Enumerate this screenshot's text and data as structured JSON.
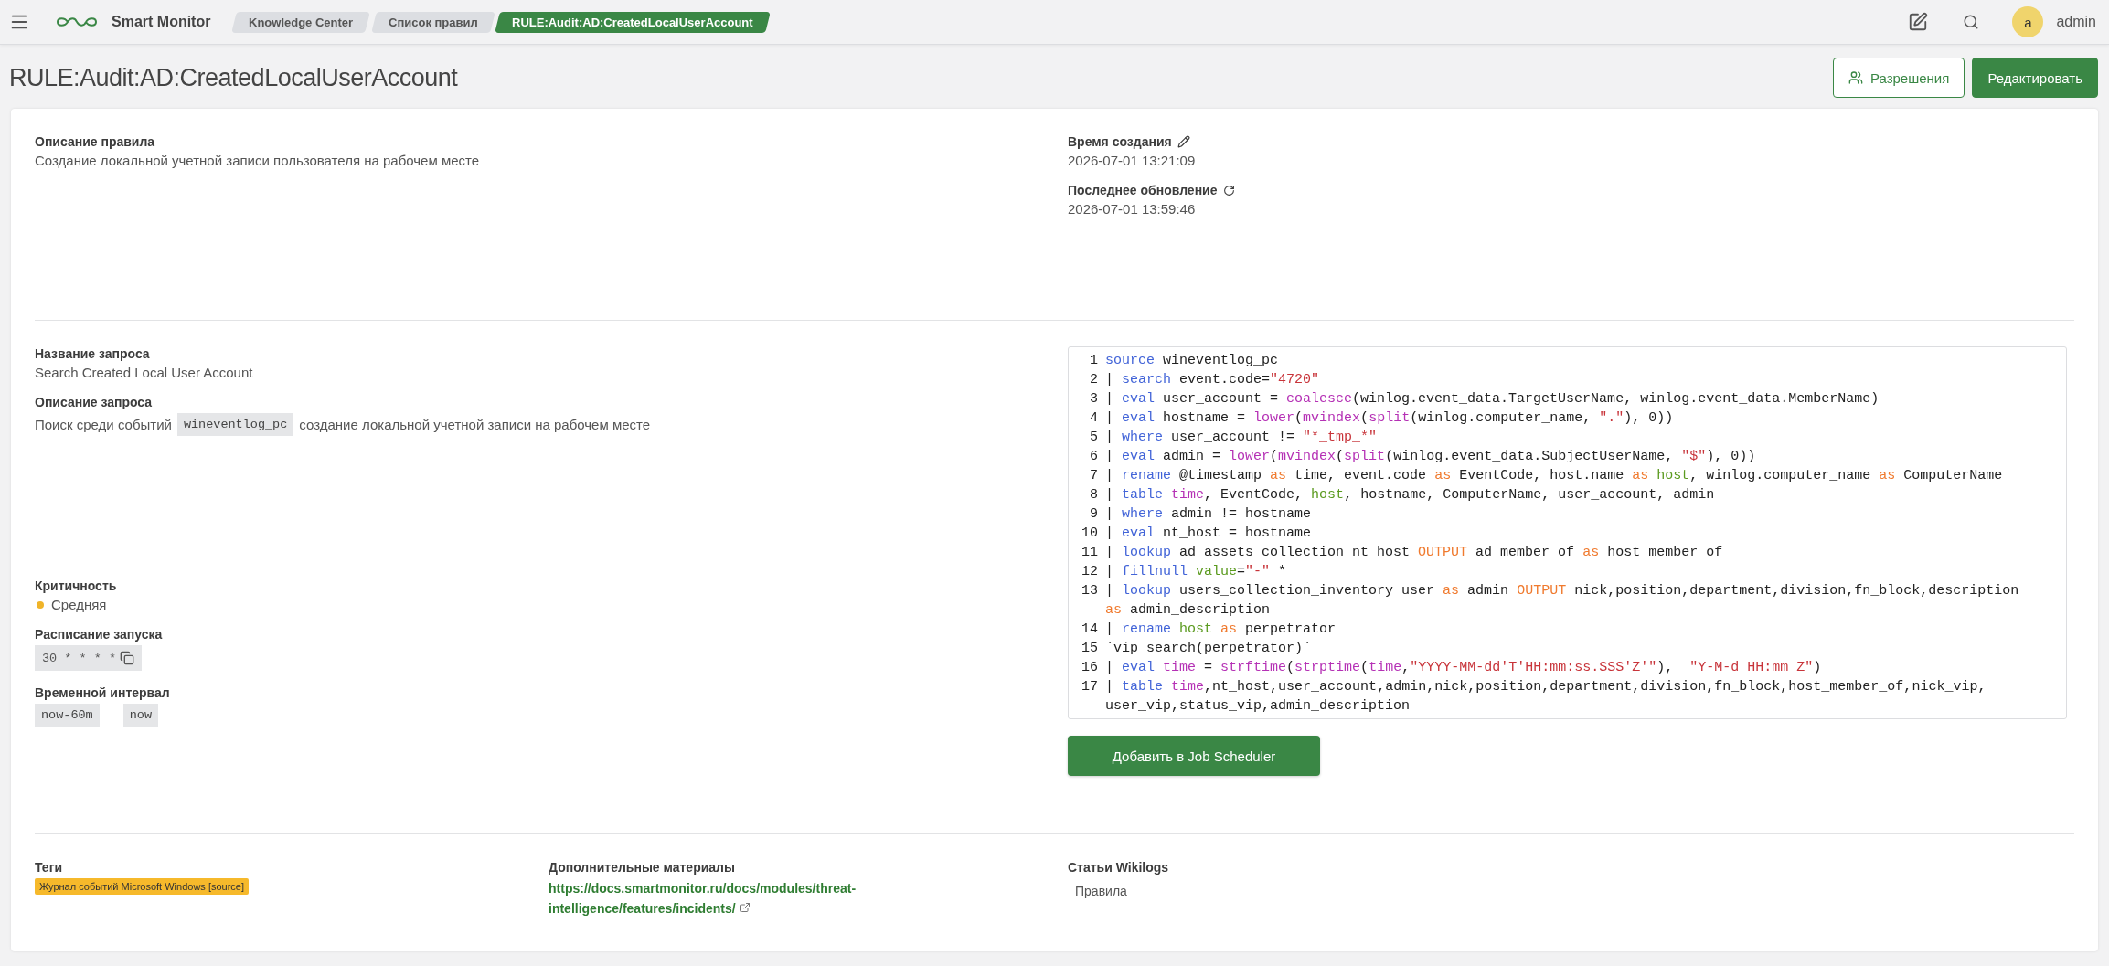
{
  "topbar": {
    "app_name": "Smart Monitor",
    "breadcrumbs": [
      {
        "label": "Knowledge Center",
        "selected": false
      },
      {
        "label": "Список правил",
        "selected": false
      },
      {
        "label": "RULE:Audit:AD:CreatedLocalUserAccount",
        "selected": true
      }
    ],
    "user": {
      "avatar_letter": "a",
      "name": "admin"
    }
  },
  "page": {
    "title": "RULE:Audit:AD:CreatedLocalUserAccount",
    "buttons": [
      {
        "label": "Разрешения",
        "kind": "outline"
      },
      {
        "label": "Редактировать",
        "kind": "primary"
      }
    ]
  },
  "rule": {
    "description_label": "Описание правила",
    "description": "Создание локальной учетной записи пользователя на рабочем месте",
    "created_label": "Время создания",
    "created": "2026-07-01 13:21:09",
    "updated_label": "Последнее обновление",
    "updated": "2026-07-01 13:59:46"
  },
  "query": {
    "name_label": "Название запроса",
    "name": "Search Created Local User Account",
    "description_label": "Описание запроса",
    "description_parts": [
      {
        "kind": "text",
        "text": "Поиск среди событий"
      },
      {
        "kind": "code",
        "text": "wineventlog_pc"
      },
      {
        "kind": "text",
        "text": "создание локальной учетной записи на рабочем месте"
      }
    ],
    "criticality": {
      "label": "Критичность",
      "value": "Средняя",
      "color": "#f0b429"
    },
    "schedule": {
      "label": "Расписание запуска",
      "value": "30 * * * *"
    },
    "interval": {
      "label": "Временной интервал",
      "values": [
        "now-60m",
        "now"
      ]
    },
    "code_lines": [
      {
        "number": "1",
        "tokens": [
          {
            "kind": "kw",
            "text": "source"
          },
          {
            "kind": "plain",
            "text": " wineventlog_pc"
          }
        ]
      },
      {
        "number": "2",
        "tokens": [
          {
            "kind": "plain",
            "text": "| "
          },
          {
            "kind": "kw",
            "text": "search"
          },
          {
            "kind": "plain",
            "text": " event.code="
          },
          {
            "kind": "str",
            "text": "\"4720\""
          }
        ]
      },
      {
        "number": "3",
        "tokens": [
          {
            "kind": "plain",
            "text": "| "
          },
          {
            "kind": "kw",
            "text": "eval"
          },
          {
            "kind": "plain",
            "text": " user_account = "
          },
          {
            "kind": "fn",
            "text": "coalesce"
          },
          {
            "kind": "plain",
            "text": "(winlog.event_data.TargetUserName, winlog.event_data.MemberName)"
          }
        ]
      },
      {
        "number": "4",
        "tokens": [
          {
            "kind": "plain",
            "text": "| "
          },
          {
            "kind": "kw",
            "text": "eval"
          },
          {
            "kind": "plain",
            "text": " hostname = "
          },
          {
            "kind": "fn",
            "text": "lower"
          },
          {
            "kind": "plain",
            "text": "("
          },
          {
            "kind": "fn",
            "text": "mvindex"
          },
          {
            "kind": "plain",
            "text": "("
          },
          {
            "kind": "fn",
            "text": "split"
          },
          {
            "kind": "plain",
            "text": "(winlog.computer_name, "
          },
          {
            "kind": "str",
            "text": "\".\""
          },
          {
            "kind": "plain",
            "text": "), 0))"
          }
        ]
      },
      {
        "number": "5",
        "tokens": [
          {
            "kind": "plain",
            "text": "| "
          },
          {
            "kind": "kw",
            "text": "where"
          },
          {
            "kind": "plain",
            "text": " user_account != "
          },
          {
            "kind": "str",
            "text": "\"*_tmp_*\""
          }
        ]
      },
      {
        "number": "6",
        "tokens": [
          {
            "kind": "plain",
            "text": "| "
          },
          {
            "kind": "kw",
            "text": "eval"
          },
          {
            "kind": "plain",
            "text": " admin = "
          },
          {
            "kind": "fn",
            "text": "lower"
          },
          {
            "kind": "plain",
            "text": "("
          },
          {
            "kind": "fn",
            "text": "mvindex"
          },
          {
            "kind": "plain",
            "text": "("
          },
          {
            "kind": "fn",
            "text": "split"
          },
          {
            "kind": "plain",
            "text": "(winlog.event_data.SubjectUserName, "
          },
          {
            "kind": "str",
            "text": "\"$\""
          },
          {
            "kind": "plain",
            "text": "), 0))"
          }
        ]
      },
      {
        "number": "7",
        "tokens": [
          {
            "kind": "plain",
            "text": "| "
          },
          {
            "kind": "kw",
            "text": "rename"
          },
          {
            "kind": "plain",
            "text": " @timestamp "
          },
          {
            "kind": "op",
            "text": "as"
          },
          {
            "kind": "plain",
            "text": " time, event.code "
          },
          {
            "kind": "op",
            "text": "as"
          },
          {
            "kind": "plain",
            "text": " EventCode, host.name "
          },
          {
            "kind": "op",
            "text": "as"
          },
          {
            "kind": "grn",
            "text": " host"
          },
          {
            "kind": "plain",
            "text": ", winlog.computer_name "
          },
          {
            "kind": "op",
            "text": "as"
          },
          {
            "kind": "plain",
            "text": " ComputerName"
          }
        ]
      },
      {
        "number": "8",
        "tokens": [
          {
            "kind": "plain",
            "text": "| "
          },
          {
            "kind": "kw",
            "text": "table"
          },
          {
            "kind": "fn",
            "text": " time"
          },
          {
            "kind": "plain",
            "text": ", EventCode, "
          },
          {
            "kind": "grn",
            "text": "host"
          },
          {
            "kind": "plain",
            "text": ", hostname, ComputerName, user_account, admin"
          }
        ]
      },
      {
        "number": "9",
        "tokens": [
          {
            "kind": "plain",
            "text": "| "
          },
          {
            "kind": "kw",
            "text": "where"
          },
          {
            "kind": "plain",
            "text": " admin != hostname"
          }
        ]
      },
      {
        "number": "10",
        "tokens": [
          {
            "kind": "plain",
            "text": "| "
          },
          {
            "kind": "kw",
            "text": "eval"
          },
          {
            "kind": "plain",
            "text": " nt_host = hostname"
          }
        ]
      },
      {
        "number": "11",
        "tokens": [
          {
            "kind": "plain",
            "text": "| "
          },
          {
            "kind": "kw",
            "text": "lookup"
          },
          {
            "kind": "plain",
            "text": " ad_assets_collection nt_host "
          },
          {
            "kind": "op",
            "text": "OUTPUT"
          },
          {
            "kind": "plain",
            "text": " ad_member_of "
          },
          {
            "kind": "op",
            "text": "as"
          },
          {
            "kind": "plain",
            "text": " host_member_of"
          }
        ]
      },
      {
        "number": "12",
        "tokens": [
          {
            "kind": "plain",
            "text": "| "
          },
          {
            "kind": "kw",
            "text": "fillnull"
          },
          {
            "kind": "grn",
            "text": " value"
          },
          {
            "kind": "plain",
            "text": "="
          },
          {
            "kind": "str",
            "text": "\"-\""
          },
          {
            "kind": "plain",
            "text": " *"
          }
        ]
      },
      {
        "number": "13",
        "tokens": [
          {
            "kind": "plain",
            "text": "| "
          },
          {
            "kind": "kw",
            "text": "lookup"
          },
          {
            "kind": "plain",
            "text": " users_collection_inventory user "
          },
          {
            "kind": "op",
            "text": "as"
          },
          {
            "kind": "plain",
            "text": " admin "
          },
          {
            "kind": "op",
            "text": "OUTPUT"
          },
          {
            "kind": "plain",
            "text": " nick,position,department,division,fn_block,description "
          },
          {
            "kind": "op",
            "text": "as"
          },
          {
            "kind": "plain",
            "text": " admin_description"
          }
        ]
      },
      {
        "number": "14",
        "tokens": [
          {
            "kind": "plain",
            "text": "| "
          },
          {
            "kind": "kw",
            "text": "rename"
          },
          {
            "kind": "grn",
            "text": " host"
          },
          {
            "kind": "op",
            "text": " as"
          },
          {
            "kind": "plain",
            "text": " perpetrator"
          }
        ]
      },
      {
        "number": "15",
        "tokens": [
          {
            "kind": "plain",
            "text": "`vip_search(perpetrator)`"
          }
        ]
      },
      {
        "number": "16",
        "tokens": [
          {
            "kind": "plain",
            "text": "| "
          },
          {
            "kind": "kw",
            "text": "eval"
          },
          {
            "kind": "fn",
            "text": " time"
          },
          {
            "kind": "plain",
            "text": " = "
          },
          {
            "kind": "fn",
            "text": "strftime"
          },
          {
            "kind": "plain",
            "text": "("
          },
          {
            "kind": "fn",
            "text": "strptime"
          },
          {
            "kind": "plain",
            "text": "("
          },
          {
            "kind": "fn",
            "text": "time"
          },
          {
            "kind": "plain",
            "text": ","
          },
          {
            "kind": "str",
            "text": "\"YYYY-MM-dd'T'HH:mm:ss.SSS'Z'\""
          },
          {
            "kind": "plain",
            "text": "),  "
          },
          {
            "kind": "str",
            "text": "\"Y-M-d HH:mm Z\""
          },
          {
            "kind": "plain",
            "text": ")"
          }
        ]
      },
      {
        "number": "17",
        "tokens": [
          {
            "kind": "plain",
            "text": "| "
          },
          {
            "kind": "kw",
            "text": "table"
          },
          {
            "kind": "fn",
            "text": " time"
          },
          {
            "kind": "plain",
            "text": ",nt_host,user_account,admin,nick,position,department,division,fn_block,host_member_of,nick_vip,user_vip,status_vip,admin_description"
          }
        ]
      }
    ],
    "scheduler_button": "Добавить в Job Scheduler"
  },
  "footer": {
    "tags_label": "Теги",
    "tags": [
      "Журнал событий Microsoft Windows [source]"
    ],
    "materials_label": "Дополнительные материалы",
    "materials_link": "https://docs.smartmonitor.ru/docs/modules/threat-intelligence/features/incidents/",
    "wiki_label": "Статьи Wikilogs",
    "wiki_items": [
      "Правила"
    ]
  }
}
